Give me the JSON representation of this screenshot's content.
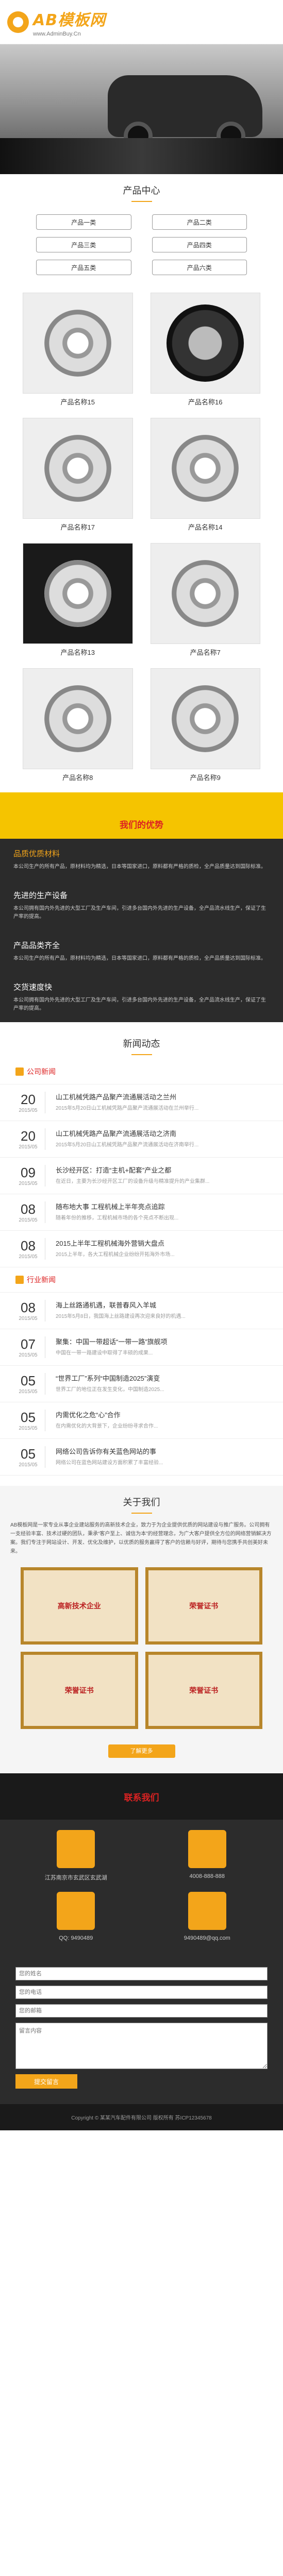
{
  "header": {
    "logo_text": "AB模板网",
    "logo_sub": "www.AdminBuy.Cn"
  },
  "banner": {
    "slogan": ""
  },
  "products": {
    "title": "产品中心",
    "categories": [
      "产品一类",
      "产品二类",
      "产品三类",
      "产品四类",
      "产品五类",
      "产品六类"
    ],
    "items": [
      {
        "name": "产品名称15",
        "kind": "bearing"
      },
      {
        "name": "产品名称16",
        "kind": "tire"
      },
      {
        "name": "产品名称17",
        "kind": "bearing"
      },
      {
        "name": "产品名称14",
        "kind": "bearing"
      },
      {
        "name": "产品名称13",
        "kind": "bearing"
      },
      {
        "name": "产品名称7",
        "kind": "bearing"
      },
      {
        "name": "产品名称8",
        "kind": "bearing"
      },
      {
        "name": "产品名称9",
        "kind": "bearing"
      }
    ]
  },
  "advantages": {
    "title": "我们的优势",
    "items": [
      {
        "title": "品质优质材料",
        "text": "本公司生产的所有产品，原材料均为精选，日本等国家进口，原料都有严格的质检，全产品质量达到国际标准。"
      },
      {
        "title": "先进的生产设备",
        "text": "本公司拥有国内外先进的大型工厂及生产车间，引进多台国内外先进的生产设备，全产品流水线生产，保证了生产率的提高。"
      },
      {
        "title": "产品品类齐全",
        "text": "本公司生产的所有产品，原材料均为精选，日本等国家进口，原料都有严格的质检，全产品质量达到国际标准。"
      },
      {
        "title": "交货速度快",
        "text": "本公司拥有国内外先进的大型工厂及生产车间，引进多台国内外先进的生产设备，全产品流水线生产，保证了生产率的提高。"
      }
    ]
  },
  "news": {
    "title": "新闻动态",
    "company_label": "公司新闻",
    "company": [
      {
        "day": "20",
        "ym": "2015/05",
        "title": "山工机械凭路产品聚产流通展活动之兰州",
        "text": "2015年5月20日山工机械凭路产品聚产流通展活动在兰州举行..."
      },
      {
        "day": "20",
        "ym": "2015/05",
        "title": "山工机械凭路产品聚产流通展活动之济南",
        "text": "2015年5月20日山工机械凭路产品聚产流通展活动在济南举行..."
      },
      {
        "day": "09",
        "ym": "2015/05",
        "title": "长沙经开区：打造“主机+配套”产业之都",
        "text": "在近日，主要为长沙经开区工厂的设备升级与精准提升的产业集群..."
      },
      {
        "day": "08",
        "ym": "2015/05",
        "title": "随布地大事 工程机械上半年亮点追踪",
        "text": "随着年份的推移，工程机械市场的各个亮点不断出现..."
      },
      {
        "day": "08",
        "ym": "2015/05",
        "title": "2015上半年工程机械海外营销大盘点",
        "text": "2015上半年，各大工程机械企业纷纷开拓海外市场..."
      }
    ],
    "industry_label": "行业新闻",
    "industry": [
      {
        "day": "08",
        "ym": "2015/05",
        "title": "海上丝路通机遇，联普春风入羊城",
        "text": "2015年5月8日，我国海上丝路建设再次迎来良好的机遇..."
      },
      {
        "day": "07",
        "ym": "2015/05",
        "title": "聚集：中国一带超话“一带一路”旗舰项",
        "text": "中国在一带一路建设中取得了丰硕的成果..."
      },
      {
        "day": "05",
        "ym": "2015/05",
        "title": "“世界工厂”系列“中国制造2025”演变",
        "text": "世界工厂的地位正在发生变化，中国制造2025..."
      },
      {
        "day": "05",
        "ym": "2015/05",
        "title": "内需优化之危“心”合作",
        "text": "在内需优化的大背景下，企业纷纷寻求合作..."
      },
      {
        "day": "05",
        "ym": "2015/05",
        "title": "网络公司告诉你有关蓝色网站的事",
        "text": "网络公司在蓝色网站建设方面积累了丰富经验..."
      }
    ]
  },
  "about": {
    "title": "关于我们",
    "text": "AB模板网是一家专业从事企业建站服务的高新技术企业，致力于为企业提供优质的网站建设与推广服务。公司拥有一支经验丰富、技术过硬的团队，秉承“客户至上、诚信为本”的经营理念，为广大客户提供全方位的网络营销解决方案。我们专注于网站设计、开发、优化及维护，以优质的服务赢得了客户的信赖与好评，期待与您携手共创美好未来。",
    "certs": [
      "高新技术企业",
      "荣誉证书",
      "荣誉证书",
      "荣誉证书"
    ],
    "more": "了解更多"
  },
  "contact": {
    "title": "联系我们",
    "address": "江苏南京市玄武区玄武湖",
    "phone": "4008-888-888",
    "qq": "QQ: 9490489",
    "email": "9490489@qq.com"
  },
  "form": {
    "name_ph": "您的姓名",
    "phone_ph": "您的电话",
    "email_ph": "您的邮箱",
    "content_ph": "留言内容",
    "submit": "提交留言"
  },
  "footer": {
    "copyright": "Copyright © 某某汽车配件有限公司 版权所有  苏ICP12345678"
  }
}
